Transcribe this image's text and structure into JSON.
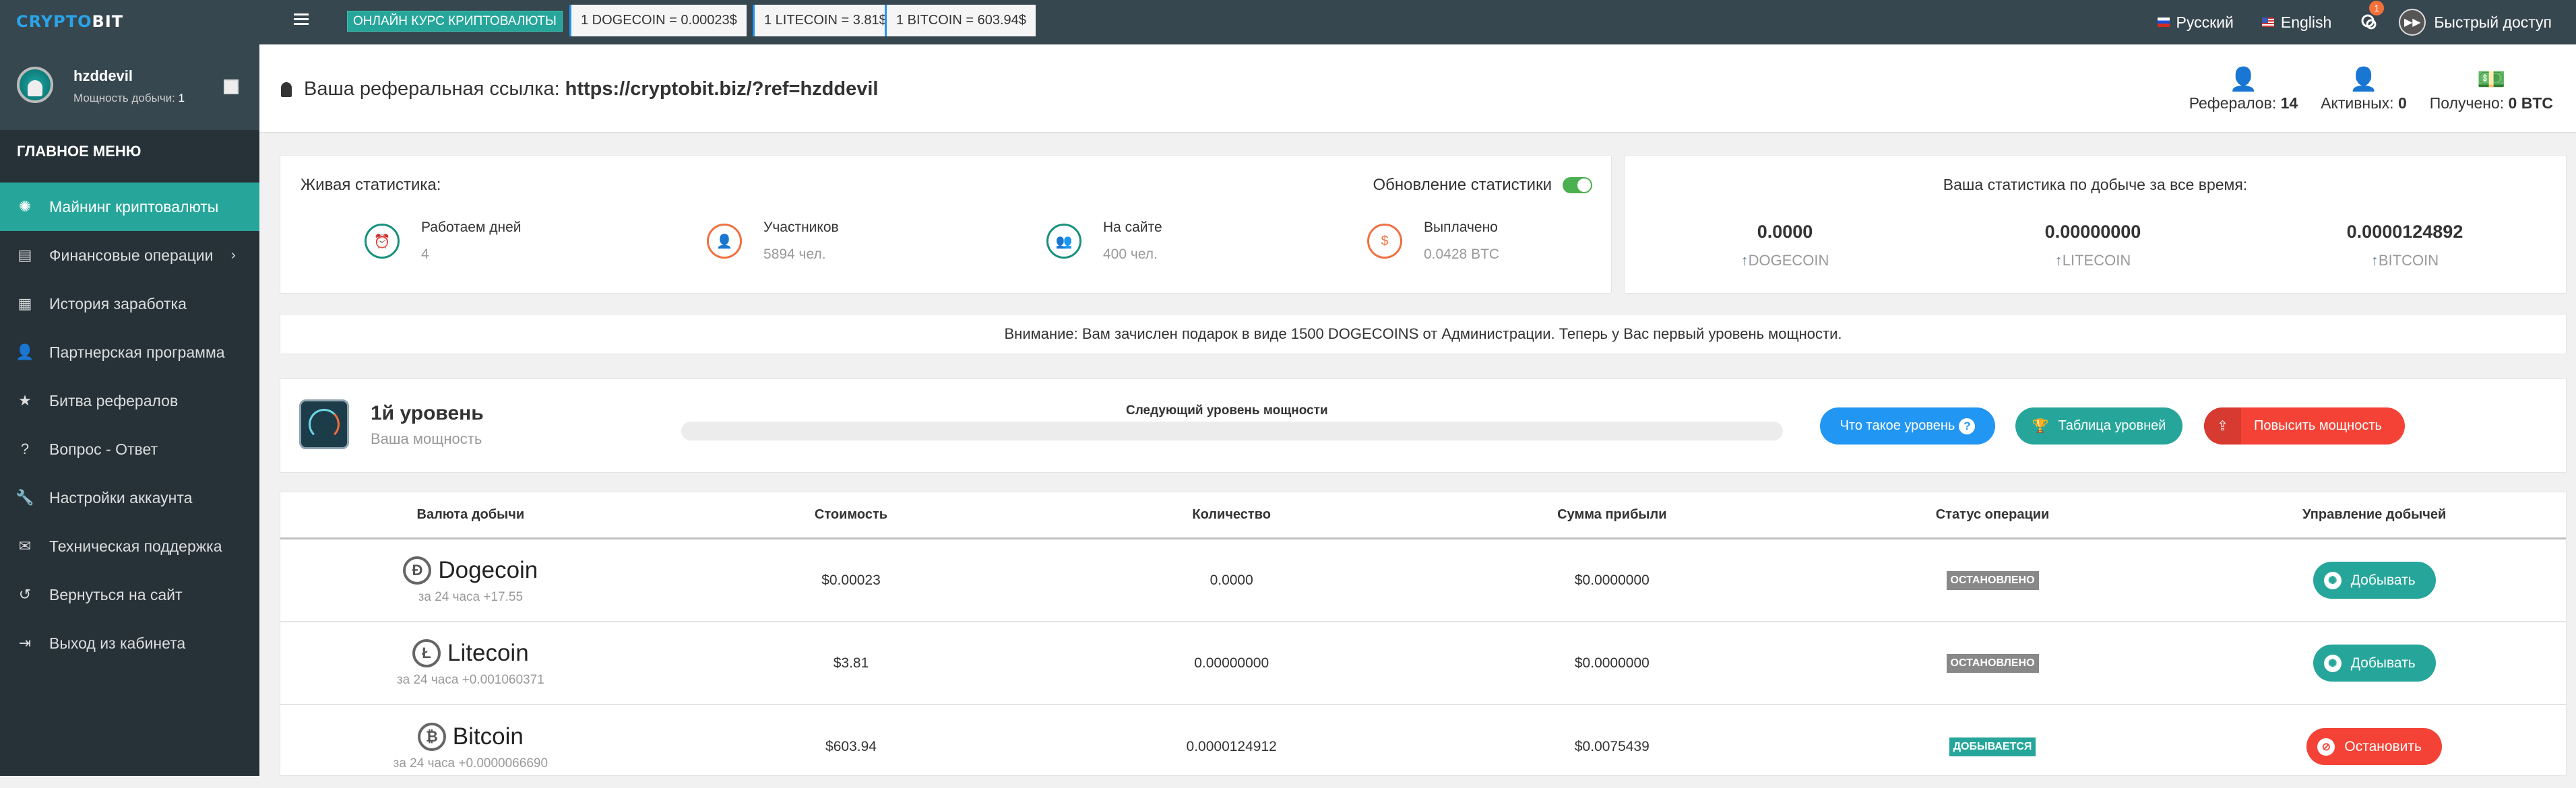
{
  "topbar": {
    "logo_part1": "CRYPTO",
    "logo_part2": "BIT",
    "menu_icon": "hamburger-icon",
    "rates_label": "ОНЛАЙН КУРС КРИПТОВАЛЮТЫ",
    "rates": [
      "1 DOGECOIN = 0.00023$",
      "1 LITECOIN = 3.81$",
      "1 BITCOIN = 603.94$"
    ],
    "lang_ru": "Русский",
    "lang_en": "English",
    "messages_badge": "1",
    "quick_access": "Быстрый доступ"
  },
  "sidebar": {
    "username": "hzddevil",
    "power_label": "Мощность добычи:",
    "power_value": "1",
    "menu_title": "ГЛАВНОЕ МЕНЮ",
    "items": [
      {
        "label": "Майнинг криптовалюты",
        "icon": "aperture-icon",
        "active": true
      },
      {
        "label": "Финансовые операции",
        "icon": "wallet-icon",
        "submenu": true
      },
      {
        "label": "История заработка",
        "icon": "calendar-icon"
      },
      {
        "label": "Партнерская программа",
        "icon": "user-icon"
      },
      {
        "label": "Битва рефералов",
        "icon": "medal-icon"
      },
      {
        "label": "Вопрос - Ответ",
        "icon": "question-icon"
      },
      {
        "label": "Настройки аккаунта",
        "icon": "wrench-icon"
      },
      {
        "label": "Техническая поддержка",
        "icon": "envelope-icon"
      },
      {
        "label": "Вернуться на сайт",
        "icon": "return-icon"
      },
      {
        "label": "Выход из кабинета",
        "icon": "logout-icon"
      }
    ]
  },
  "referral": {
    "label": "Ваша реферальная ссылка:",
    "link": "https://cryptobit.biz/?ref=hzddevil",
    "referrals_label": "Рефералов:",
    "referrals_value": "14",
    "active_label": "Активных:",
    "active_value": "0",
    "received_label": "Получено:",
    "received_value": "0 BTC"
  },
  "live_stats": {
    "title": "Живая статистика:",
    "toggle_label": "Обновление статистики",
    "toggle_on": true,
    "items": [
      {
        "label": "Работаем дней",
        "value": "4"
      },
      {
        "label": "Участников",
        "value": "5894 чел."
      },
      {
        "label": "На сайте",
        "value": "400 чел."
      },
      {
        "label": "Выплачено",
        "value": "0.0428 BTC"
      }
    ]
  },
  "alltime": {
    "title": "Ваша статистика по добыче за все время:",
    "items": [
      {
        "value": "0.0000",
        "label": "DOGECOIN"
      },
      {
        "value": "0.00000000",
        "label": "LITECOIN"
      },
      {
        "value": "0.0000124892",
        "label": "BITCOIN"
      }
    ]
  },
  "notice": "Внимание: Вам зачислен подарок в виде 1500 DOGECOINS от Администрации. Теперь у Вас первый уровень мощности.",
  "level": {
    "title": "1й уровень",
    "subtitle": "Ваша мощность",
    "next_label": "Следующий уровень мощности",
    "progress_percent": 0,
    "btn_what": "Что такое уровень",
    "btn_table": "Таблица уровней",
    "btn_boost": "Повысить мощность"
  },
  "table": {
    "headers": [
      "Валюта добычи",
      "Стоимость",
      "Количество",
      "Сумма прибыли",
      "Статус операции",
      "Управление добычей"
    ],
    "rows": [
      {
        "coin": "Dogecoin",
        "symbol": "Ð",
        "change": "за 24 часа +17.55",
        "price": "$0.00023",
        "amount": "0.0000",
        "profit": "$0.0000000",
        "status": "ОСТАНОВЛЕНО",
        "action": "Добывать"
      },
      {
        "coin": "Litecoin",
        "symbol": "Ł",
        "change": "за 24 часа +0.001060371",
        "price": "$3.81",
        "amount": "0.00000000",
        "profit": "$0.0000000",
        "status": "ОСТАНОВЛЕНО",
        "action": "Добывать"
      },
      {
        "coin": "Bitcoin",
        "symbol": "₿",
        "change": "за 24 часа +0.0000066690",
        "price": "$603.94",
        "amount": "0.0000124912",
        "profit": "$0.0075439",
        "status": "ДОБЫВАЕТСЯ",
        "action": "Остановить"
      }
    ]
  }
}
